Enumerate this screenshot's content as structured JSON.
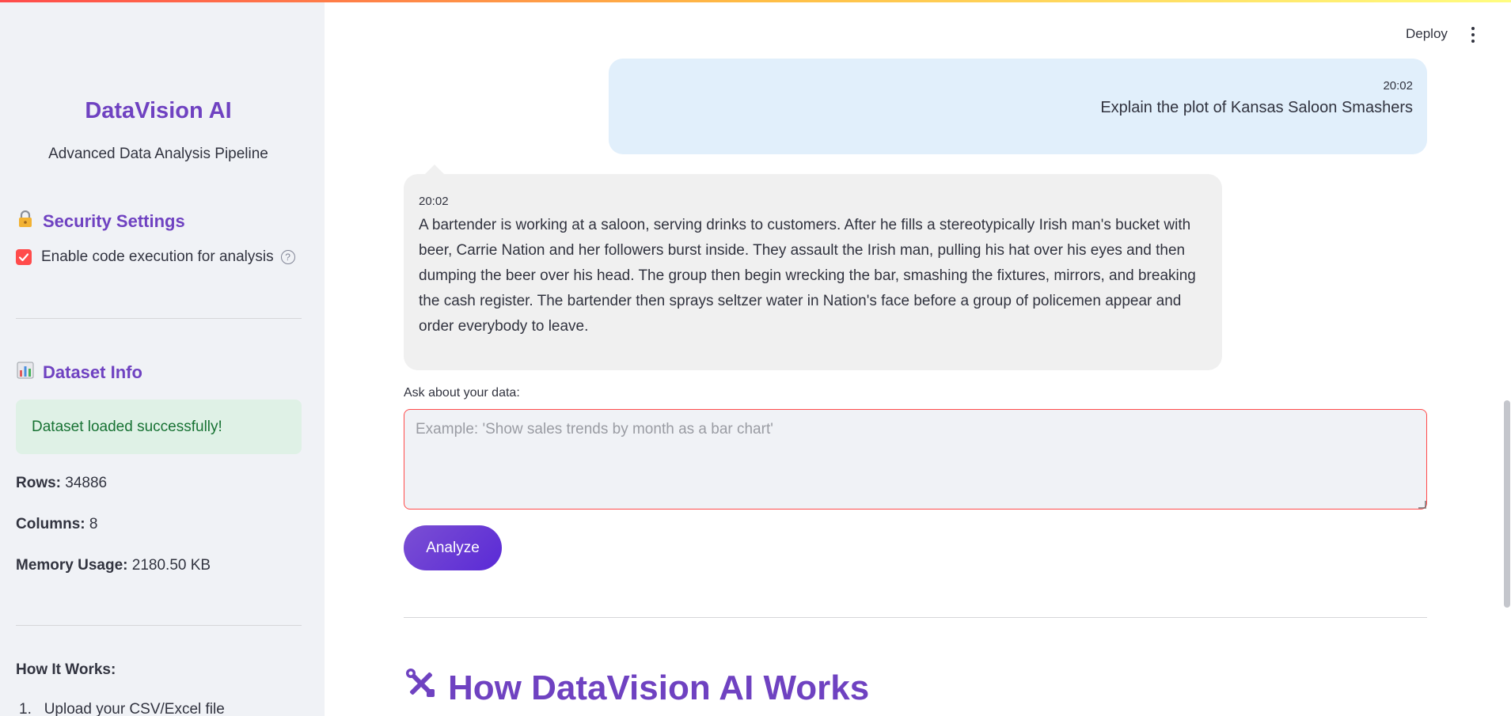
{
  "sidebar": {
    "app_title": "DataVision AI",
    "app_subtitle": "Advanced Data Analysis Pipeline",
    "security_heading": "Security Settings",
    "security_icon": "lock-icon",
    "code_exec_label": "Enable code execution for analysis",
    "code_exec_checked": true,
    "dataset_heading": "Dataset Info",
    "dataset_icon": "bar-chart-icon",
    "success_message": "Dataset loaded successfully!",
    "rows_label": "Rows:",
    "rows_value": "34886",
    "columns_label": "Columns:",
    "columns_value": "8",
    "memory_label": "Memory Usage:",
    "memory_value": "2180.50 KB",
    "how_heading": "How It Works:",
    "steps": [
      {
        "num": "1.",
        "text": "Upload your CSV/Excel file"
      }
    ]
  },
  "header": {
    "deploy_label": "Deploy"
  },
  "chat": {
    "user_message": {
      "time": "20:02",
      "text": "Explain the plot of Kansas Saloon Smashers"
    },
    "ai_message": {
      "time": "20:02",
      "text": "A bartender is working at a saloon, serving drinks to customers. After he fills a stereotypically Irish man's bucket with beer, Carrie Nation and her followers burst inside. They assault the Irish man, pulling his hat over his eyes and then dumping the beer over his head. The group then begin wrecking the bar, smashing the fixtures, mirrors, and breaking the cash register. The bartender then sprays seltzer water in Nation's face before a group of policemen appear and order everybody to leave."
    }
  },
  "query": {
    "label": "Ask about your data:",
    "placeholder": "Example: 'Show sales trends by month as a bar chart'",
    "value": "",
    "button_label": "Analyze"
  },
  "section": {
    "heading": "How DataVision AI Works",
    "heading_icon": "tools-icon"
  },
  "colors": {
    "accent": "#6f42c1",
    "error_border": "#ff4b4b",
    "success_bg": "#dff1e6",
    "success_text": "#177233",
    "user_bubble": "#e1effb",
    "ai_bubble": "#f0f0f0"
  }
}
